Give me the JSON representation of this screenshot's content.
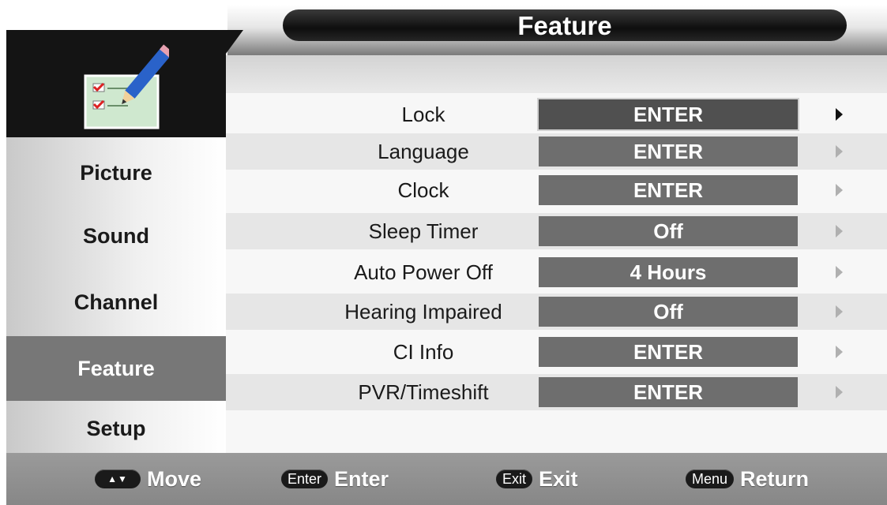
{
  "header": {
    "title": "Feature"
  },
  "sidebar": {
    "icon": "checklist-pencil-icon",
    "items": [
      {
        "label": "Picture",
        "active": false
      },
      {
        "label": "Sound",
        "active": false
      },
      {
        "label": "Channel",
        "active": false
      },
      {
        "label": "Feature",
        "active": true
      },
      {
        "label": "Setup",
        "active": false
      }
    ]
  },
  "menu": {
    "rows": [
      {
        "label": "Lock",
        "value": "ENTER",
        "selected": true
      },
      {
        "label": "Language",
        "value": "ENTER"
      },
      {
        "label": "Clock",
        "value": "ENTER"
      },
      {
        "label": "Sleep Timer",
        "value": "Off"
      },
      {
        "label": "Auto Power Off",
        "value": "4 Hours"
      },
      {
        "label": "Hearing Impaired",
        "value": "Off"
      },
      {
        "label": "CI Info",
        "value": "ENTER"
      },
      {
        "label": "PVR/Timeshift",
        "value": "ENTER"
      }
    ]
  },
  "footer": {
    "hints": [
      {
        "key": "▲▼",
        "icon": "up-down-arrows-icon",
        "action": "Move"
      },
      {
        "key": "Enter",
        "action": "Enter"
      },
      {
        "key": "Exit",
        "action": "Exit"
      },
      {
        "key": "Menu",
        "action": "Return"
      }
    ]
  },
  "colors": {
    "active_tab": "#777777",
    "value_box": "#6e6e6e",
    "title_pill": "#1a1a1a",
    "hint_bar": "#909090"
  }
}
